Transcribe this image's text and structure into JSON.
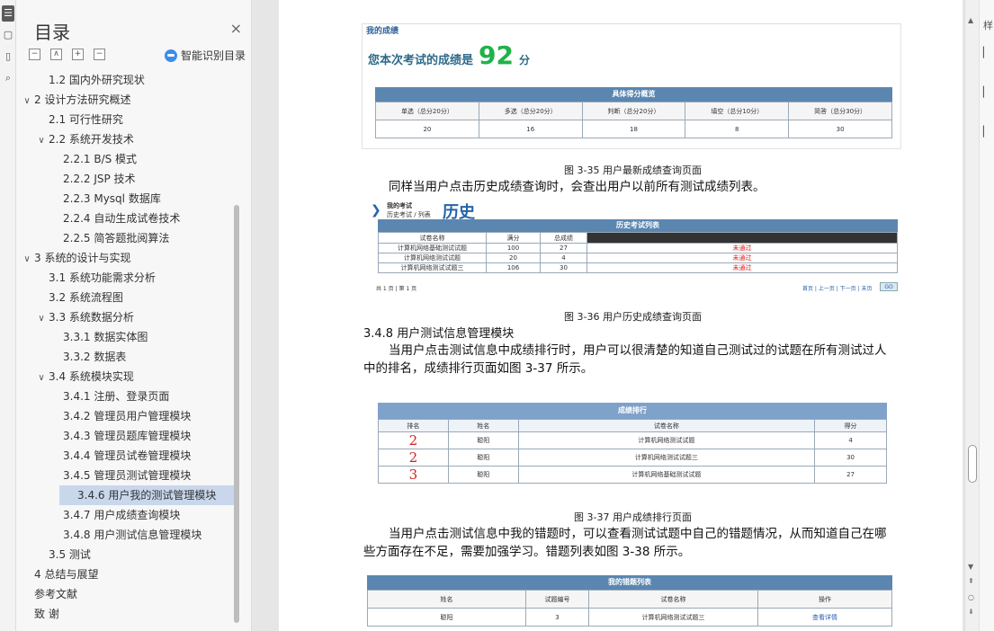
{
  "rail": {
    "icons": [
      "toc-icon",
      "page-icon",
      "bookmark-icon",
      "search-icon"
    ]
  },
  "toc": {
    "title": "目录",
    "close": "×",
    "tools": {
      "collapse": "−",
      "up": "∧",
      "add": "+",
      "remove": "−"
    },
    "ai_label": "智能识别目录",
    "items": [
      {
        "label": "1.2  国内外研究现状",
        "level": 2,
        "chev": ""
      },
      {
        "label": "2  设计方法研究概述",
        "level": 1,
        "chev": "∨"
      },
      {
        "label": "2.1  可行性研究",
        "level": 2,
        "chev": ""
      },
      {
        "label": "2.2  系统开发技术",
        "level": 2,
        "chev": "∨"
      },
      {
        "label": "2.2.1    B/S 模式",
        "level": 3,
        "chev": ""
      },
      {
        "label": "2.2.2 JSP 技术",
        "level": 3,
        "chev": ""
      },
      {
        "label": "2.2.3 Mysql 数据库",
        "level": 3,
        "chev": ""
      },
      {
        "label": "2.2.4  自动生成试卷技术",
        "level": 3,
        "chev": ""
      },
      {
        "label": "2.2.5   简答题批阅算法",
        "level": 3,
        "chev": ""
      },
      {
        "label": "3  系统的设计与实现",
        "level": 1,
        "chev": "∨"
      },
      {
        "label": "3.1  系统功能需求分析",
        "level": 2,
        "chev": ""
      },
      {
        "label": "3.2  系统流程图",
        "level": 2,
        "chev": ""
      },
      {
        "label": "3.3  系统数据分析",
        "level": 2,
        "chev": "∨"
      },
      {
        "label": "3.3.1     数据实体图",
        "level": 3,
        "chev": ""
      },
      {
        "label": "3.3.2     数据表",
        "level": 3,
        "chev": ""
      },
      {
        "label": "3.4  系统模块实现",
        "level": 2,
        "chev": "∨"
      },
      {
        "label": "3.4.1  注册、登录页面",
        "level": 3,
        "chev": ""
      },
      {
        "label": "3.4.2  管理员用户管理模块",
        "level": 3,
        "chev": ""
      },
      {
        "label": "3.4.3  管理员题库管理模块",
        "level": 3,
        "chev": ""
      },
      {
        "label": "3.4.4  管理员试卷管理模块",
        "level": 3,
        "chev": ""
      },
      {
        "label": "3.4.5  管理员测试管理模块",
        "level": 3,
        "chev": ""
      },
      {
        "label": "3.4.6 用户我的测试管理模块",
        "level": 3,
        "chev": "",
        "selected": true
      },
      {
        "label": "3.4.7 用户成绩查询模块",
        "level": 3,
        "chev": ""
      },
      {
        "label": "3.4.8 用户测试信息管理模块",
        "level": 3,
        "chev": ""
      },
      {
        "label": "3.5  测试",
        "level": 2,
        "chev": ""
      },
      {
        "label": "4  总结与展望",
        "level": 1,
        "chev": ""
      },
      {
        "label": "参考文献",
        "level": 1,
        "chev": ""
      },
      {
        "label": "致   谢",
        "level": 1,
        "chev": ""
      }
    ]
  },
  "doc": {
    "fig35": {
      "header": "我的成绩",
      "score_prefix": "您本次考试的成绩是",
      "score": "92",
      "score_suffix": "分",
      "table_title": "具体得分概览",
      "cols": [
        "单选（总分20分）",
        "多选（总分20分）",
        "判断（总分20分）",
        "填空（总分10分）",
        "简答（总分30分）"
      ],
      "vals": [
        "20",
        "16",
        "18",
        "8",
        "30"
      ],
      "caption": "图 3-35 用户最新成绩查询页面"
    },
    "para1": "同样当用户点击历史成绩查询时，会查出用户以前所有测试成绩列表。",
    "fig36": {
      "crumb1": "我的考试",
      "crumb2": "历史考试 / 列表",
      "big": "历史",
      "table_title": "历史考试列表",
      "cols": [
        "试卷名称",
        "满分",
        "总成绩",
        ""
      ],
      "rows": [
        [
          "计算机网络基础测试试题",
          "100",
          "27",
          "未通过"
        ],
        [
          "计算机网络测试试题",
          "20",
          "4",
          "未通过"
        ],
        [
          "计算机网络测试试题三",
          "106",
          "30",
          "未通过"
        ]
      ],
      "pager_left": "共 1 页 | 第 1 页",
      "pager_right": "首页 | 上一页 | 下一页 | 末页",
      "go": "GO",
      "caption": "图 3-36 用户历史成绩查询页面"
    },
    "heading348": "3.4.8 用户测试信息管理模块",
    "para2a": "当用户点击测试信息中成绩排行时，用户可以很清楚的知道自己测试过的试题在所有测试过人",
    "para2b": "中的排名，成绩排行页面如图 3-37 所示。",
    "fig37": {
      "table_title": "成绩排行",
      "cols": [
        "排名",
        "姓名",
        "试卷名称",
        "得分"
      ],
      "rows": [
        [
          "2",
          "聪阳",
          "计算机网络测试试题",
          "4"
        ],
        [
          "2",
          "聪阳",
          "计算机网络测试试题三",
          "30"
        ],
        [
          "3",
          "聪阳",
          "计算机网络基础测试试题",
          "27"
        ]
      ],
      "caption": "图 3-37 用户成绩排行页面"
    },
    "para3a": "当用户点击测试信息中我的错题时，可以查看测试试题中自己的错题情况，从而知道自己在哪",
    "para3b": "些方面存在不足，需要加强学习。错题列表如图 3-38 所示。",
    "fig38": {
      "table_title": "我的错题列表",
      "cols": [
        "姓名",
        "试题编号",
        "试卷名称",
        "操作"
      ],
      "rows": [
        [
          "聪阳",
          "3",
          "计算机网络测试试题三",
          "查看详情"
        ]
      ]
    }
  },
  "right": {
    "top_label": "样",
    "icons": [
      "chevron-up-icon",
      "chevron-down-icon",
      "dot-icon",
      "chevron-double-down-icon"
    ]
  },
  "colors": {
    "accent": "#5b86b0",
    "score_green": "#1fb24a",
    "fail_red": "#e02020",
    "rank_red": "#d62020",
    "selected": "#c8d7ec"
  }
}
